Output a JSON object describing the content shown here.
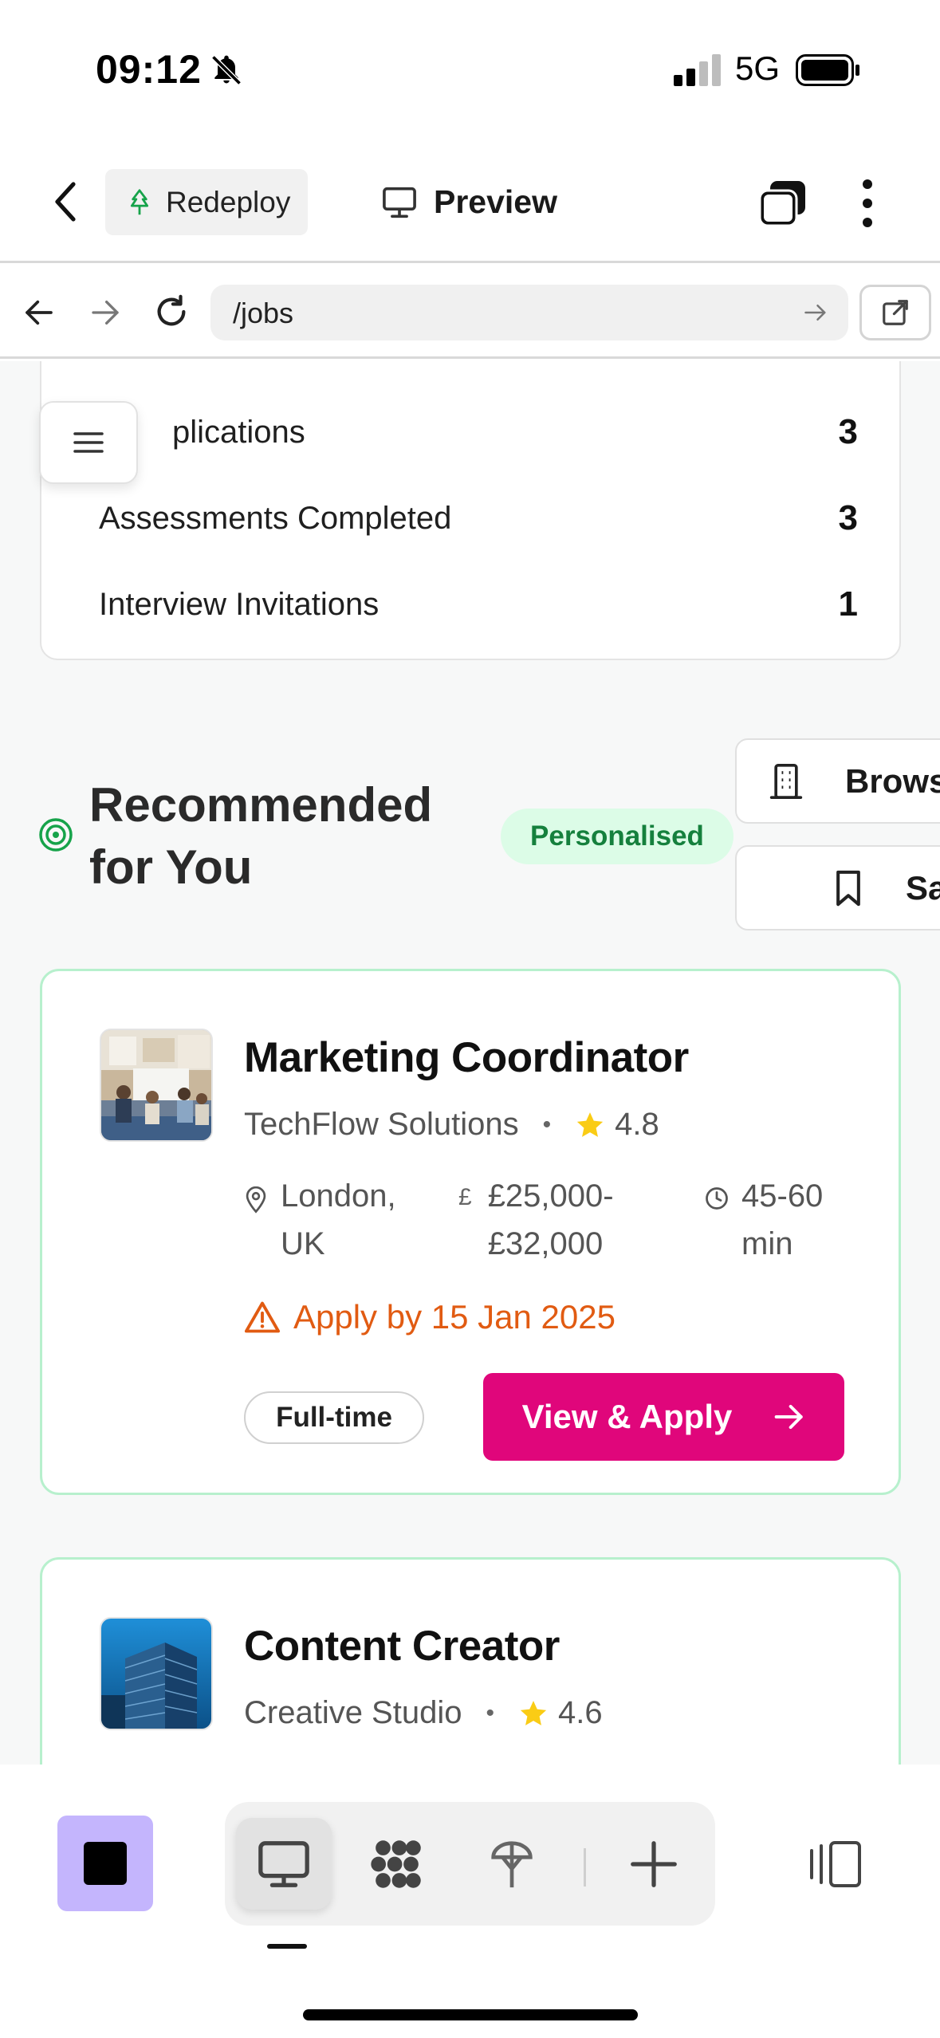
{
  "status_bar": {
    "time": "09:12",
    "network": "5G"
  },
  "toolbar": {
    "redeploy_label": "Redeploy",
    "preview_label": "Preview"
  },
  "browser": {
    "url": "/jobs"
  },
  "stats": {
    "rows": [
      {
        "label": "plications",
        "value": "3"
      },
      {
        "label": "Assessments Completed",
        "value": "3"
      },
      {
        "label": "Interview Invitations",
        "value": "1"
      }
    ]
  },
  "recommended": {
    "title": "Recommended for You",
    "badge": "Personalised",
    "browse_label": "Brows",
    "saved_label": "Sa"
  },
  "jobs": [
    {
      "title": "Marketing Coordinator",
      "company": "TechFlow Solutions",
      "rating": "4.8",
      "location": "London, UK",
      "salary_symbol": "£",
      "salary": "£25,000-£32,000",
      "duration": "45-60 min",
      "deadline": "Apply by 15 Jan 2025",
      "type": "Full-time",
      "cta": "View & Apply"
    },
    {
      "title": "Content Creator",
      "company": "Creative Studio",
      "rating": "4.6"
    }
  ],
  "colors": {
    "accent_pink": "#e0067b",
    "green_badge_bg": "#dcfce7",
    "green_badge_text": "#15803d",
    "deadline_orange": "#e15b12",
    "star_yellow": "#facc15",
    "app_square": "#c4b5fd"
  },
  "icons": [
    "bell-off-icon",
    "signal-icon",
    "battery-icon",
    "chevron-left-icon",
    "tree-icon",
    "monitor-icon",
    "tabs-icon",
    "more-vertical-icon",
    "arrow-left-icon",
    "arrow-right-icon",
    "reload-icon",
    "external-link-icon",
    "menu-icon",
    "target-icon",
    "building-icon",
    "bookmark-icon",
    "star-icon",
    "map-pin-icon",
    "clock-icon",
    "warning-icon",
    "grid-icon",
    "plus-icon",
    "panel-icon"
  ]
}
